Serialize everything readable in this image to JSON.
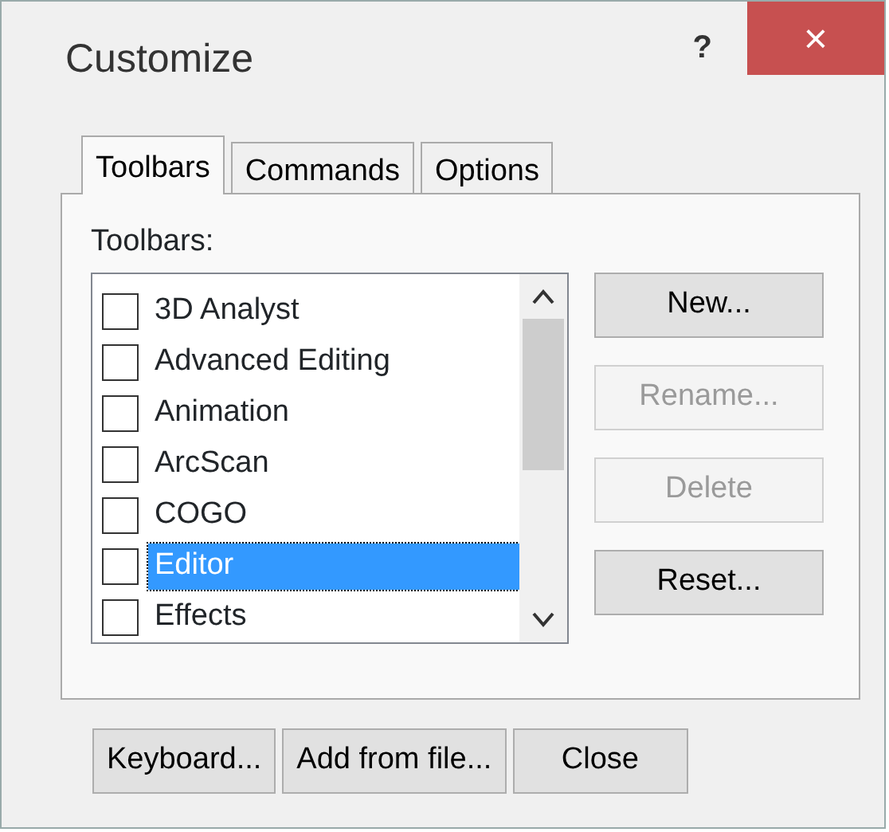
{
  "window": {
    "title": "Customize",
    "help": "?",
    "close": "×"
  },
  "tabs": [
    {
      "label": "Toolbars",
      "selected": true
    },
    {
      "label": "Commands",
      "selected": false
    },
    {
      "label": "Options",
      "selected": false
    }
  ],
  "list_label": "Toolbars:",
  "toolbars": [
    {
      "label": "3D Analyst",
      "checked": false,
      "selected": false
    },
    {
      "label": "Advanced Editing",
      "checked": false,
      "selected": false
    },
    {
      "label": "Animation",
      "checked": false,
      "selected": false
    },
    {
      "label": "ArcScan",
      "checked": false,
      "selected": false
    },
    {
      "label": "COGO",
      "checked": false,
      "selected": false
    },
    {
      "label": "Editor",
      "checked": false,
      "selected": true
    },
    {
      "label": "Effects",
      "checked": false,
      "selected": false
    }
  ],
  "side_buttons": [
    {
      "label": "New...",
      "disabled": false
    },
    {
      "label": "Rename...",
      "disabled": true
    },
    {
      "label": "Delete",
      "disabled": true
    },
    {
      "label": "Reset...",
      "disabled": false
    }
  ],
  "bottom_buttons": [
    "Keyboard...",
    "Add from file...",
    "Close"
  ]
}
